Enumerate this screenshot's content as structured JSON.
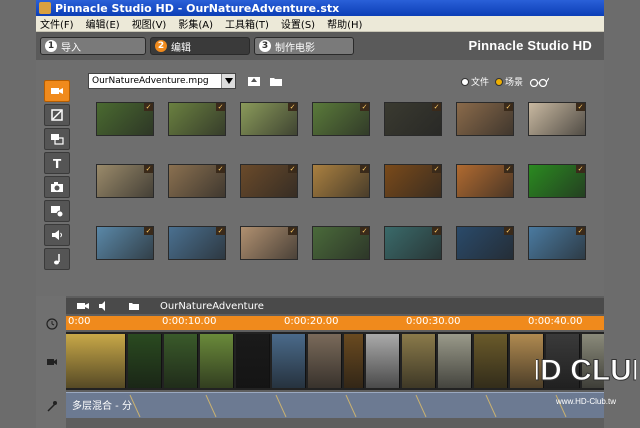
{
  "window": {
    "title": "Pinnacle Studio HD - OurNatureAdventure.stx"
  },
  "menu": [
    "文件(F)",
    "编辑(E)",
    "视图(V)",
    "影集(A)",
    "工具箱(T)",
    "设置(S)",
    "帮助(H)"
  ],
  "tabs": [
    {
      "num": "1",
      "label": "导入"
    },
    {
      "num": "2",
      "label": "编辑"
    },
    {
      "num": "3",
      "label": "制作电影"
    }
  ],
  "brand": "Pinnacle Studio HD",
  "album": {
    "file": "OurNatureAdventure.mpg",
    "view_options": [
      "文件",
      "场景"
    ],
    "selected_view": "场景"
  },
  "thumbnail_colors": [
    [
      "#4a6a30",
      "#6a8040",
      "#8a9a5a",
      "#5a7a3a",
      "#3a3a30",
      "#8a6a4a",
      "#c8b8a0"
    ],
    [
      "#9a8a6a",
      "#8a7050",
      "#6a4a2a",
      "#aa8040",
      "#7a4a1a",
      "#b06a30",
      "#2a8a20"
    ],
    [
      "#5a88a8",
      "#4a7090",
      "#b09070",
      "#4a6a3a",
      "#3a6a6a",
      "#2a4a6a",
      "#4a7aa0"
    ]
  ],
  "timeline": {
    "project": "OurNatureAdventure",
    "ticks": [
      "0:00",
      "0:00:10.00",
      "0:00:20.00",
      "0:00:30.00",
      "0:00:40.00"
    ],
    "audio_label": "多层混合 - 分",
    "clip_colors": [
      "#c8a848",
      "#2a4a20",
      "#3a5a2a",
      "#6a8a3a",
      "#1a1a1a",
      "#4a6a8a",
      "#7a6a5a",
      "#6a4a20",
      "#aaaaaa",
      "#8a7a4a",
      "#9a9a8a",
      "#6a5a2a",
      "#b08a50",
      "#3a3a3a",
      "#8a8a7a"
    ]
  },
  "watermark": {
    "brand_text": "HD CLUB",
    "url": "www.HD-Club.tw"
  }
}
